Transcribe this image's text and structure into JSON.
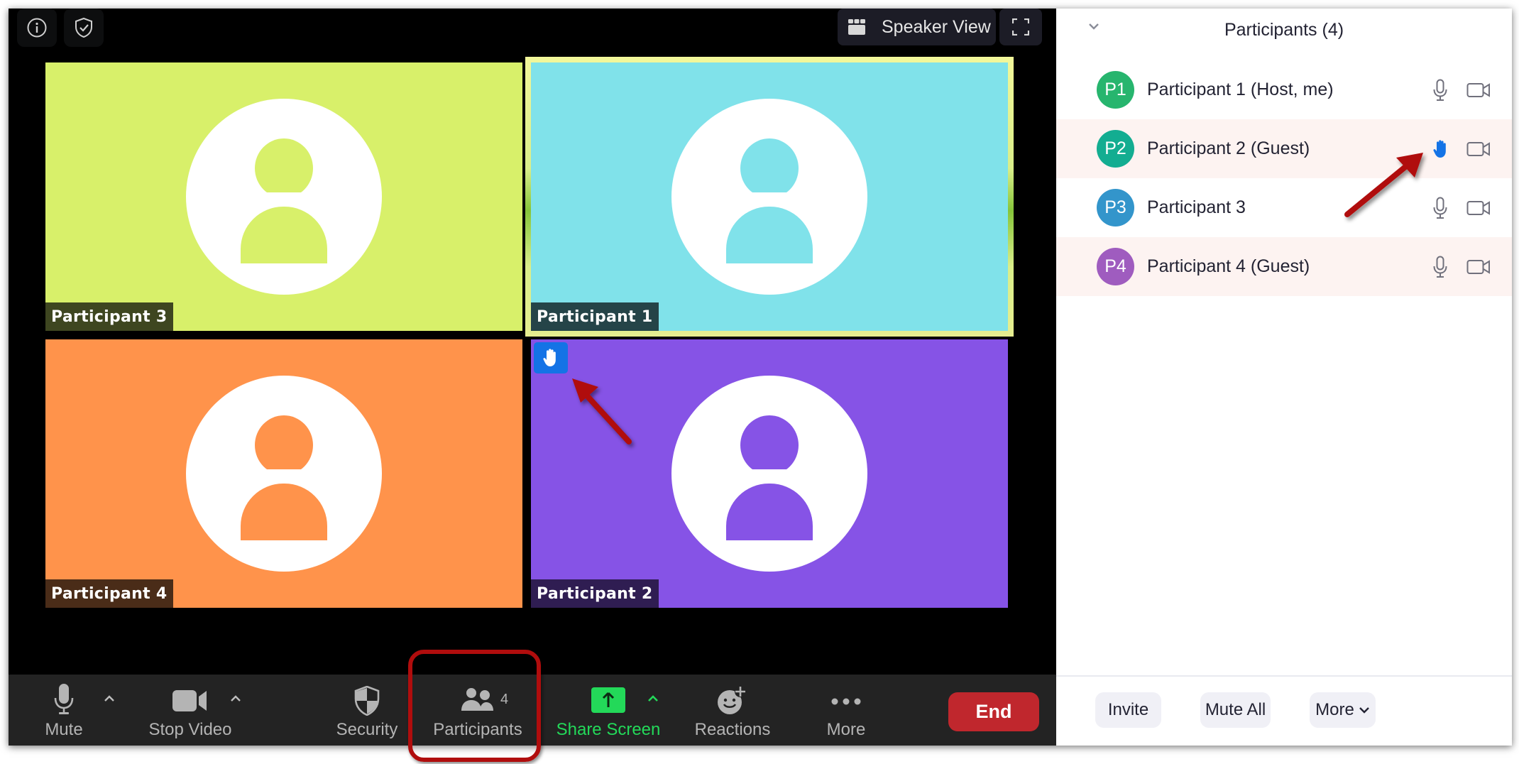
{
  "meeting": {
    "info_icon": "info-icon",
    "security_badge_icon": "shield-check-icon",
    "view_button": {
      "label": "Speaker View",
      "icon": "grid-view-icon"
    },
    "fullscreen_icon": "fullscreen-icon"
  },
  "tiles": [
    {
      "name": "Participant 3",
      "color": "#d8f06a",
      "label_bg": "#3e4620",
      "active": false,
      "hand_raised": false
    },
    {
      "name": "Participant 1",
      "color": "#80e2ea",
      "label_bg": "#254448",
      "active": true,
      "hand_raised": false
    },
    {
      "name": "Participant 4",
      "color": "#ff934b",
      "label_bg": "#4a2c18",
      "active": false,
      "hand_raised": false
    },
    {
      "name": "Participant 2",
      "color": "#8653e6",
      "label_bg": "#2f1d52",
      "active": false,
      "hand_raised": true
    }
  ],
  "toolbar": {
    "mute": "Mute",
    "stop_video": "Stop Video",
    "security": "Security",
    "participants": "Participants",
    "participants_count": "4",
    "share_screen": "Share Screen",
    "reactions": "Reactions",
    "more": "More",
    "end": "End",
    "colors": {
      "share": "#23d959",
      "end": "#c0272d"
    }
  },
  "panel": {
    "title": "Participants (4)",
    "participants": [
      {
        "initials": "P1",
        "name": "Participant 1 (Host, me)",
        "avatar_color": "#27b56e",
        "status_icon": "microphone-icon",
        "highlighted": false
      },
      {
        "initials": "P2",
        "name": "Participant 2 (Guest)",
        "avatar_color": "#13ad91",
        "status_icon": "raised-hand-icon",
        "highlighted": true
      },
      {
        "initials": "P3",
        "name": "Participant 3",
        "avatar_color": "#3395cb",
        "status_icon": "microphone-icon",
        "highlighted": false
      },
      {
        "initials": "P4",
        "name": "Participant 4 (Guest)",
        "avatar_color": "#9f5cbf",
        "status_icon": "microphone-icon",
        "highlighted": true
      }
    ],
    "buttons": {
      "invite": "Invite",
      "mute_all": "Mute All",
      "more": "More"
    }
  },
  "annotations": {
    "arrow_color": "#b00d0d",
    "items": [
      "arrow-to-tile-hand",
      "arrow-to-panel-hand",
      "box-around-participants-button"
    ]
  }
}
